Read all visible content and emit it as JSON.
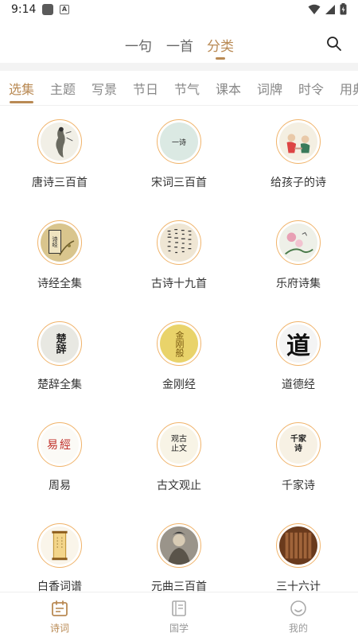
{
  "status": {
    "time": "9:14"
  },
  "top_tabs": [
    {
      "label": "一句"
    },
    {
      "label": "一首"
    },
    {
      "label": "分类"
    }
  ],
  "categories": [
    "选集",
    "主题",
    "写景",
    "节日",
    "节气",
    "课本",
    "词牌",
    "时令",
    "用典"
  ],
  "books": [
    {
      "title": "唐诗三百首",
      "cover_glyph": ""
    },
    {
      "title": "宋词三百首",
      "cover_glyph": "一诗"
    },
    {
      "title": "给孩子的诗",
      "cover_glyph": ""
    },
    {
      "title": "诗经全集",
      "cover_glyph": "诗经"
    },
    {
      "title": "古诗十九首",
      "cover_glyph": ""
    },
    {
      "title": "乐府诗集",
      "cover_glyph": ""
    },
    {
      "title": "楚辞全集",
      "cover_glyph": "楚辞"
    },
    {
      "title": "金刚经",
      "cover_glyph": "金刚般"
    },
    {
      "title": "道德经",
      "cover_glyph": "道"
    },
    {
      "title": "周易",
      "cover_glyph": "易經"
    },
    {
      "title": "古文观止",
      "cover_glyph": "观古止文"
    },
    {
      "title": "千家诗",
      "cover_glyph": "千家诗"
    },
    {
      "title": "白香词谱",
      "cover_glyph": ""
    },
    {
      "title": "元曲三百首",
      "cover_glyph": ""
    },
    {
      "title": "三十六计",
      "cover_glyph": ""
    }
  ],
  "bottom_nav": [
    {
      "label": "诗词",
      "icon": "calendar-icon"
    },
    {
      "label": "国学",
      "icon": "book-icon"
    },
    {
      "label": "我的",
      "icon": "smile-icon"
    }
  ],
  "colors": {
    "accent": "#b98a54",
    "ring": "#f0b36a"
  }
}
